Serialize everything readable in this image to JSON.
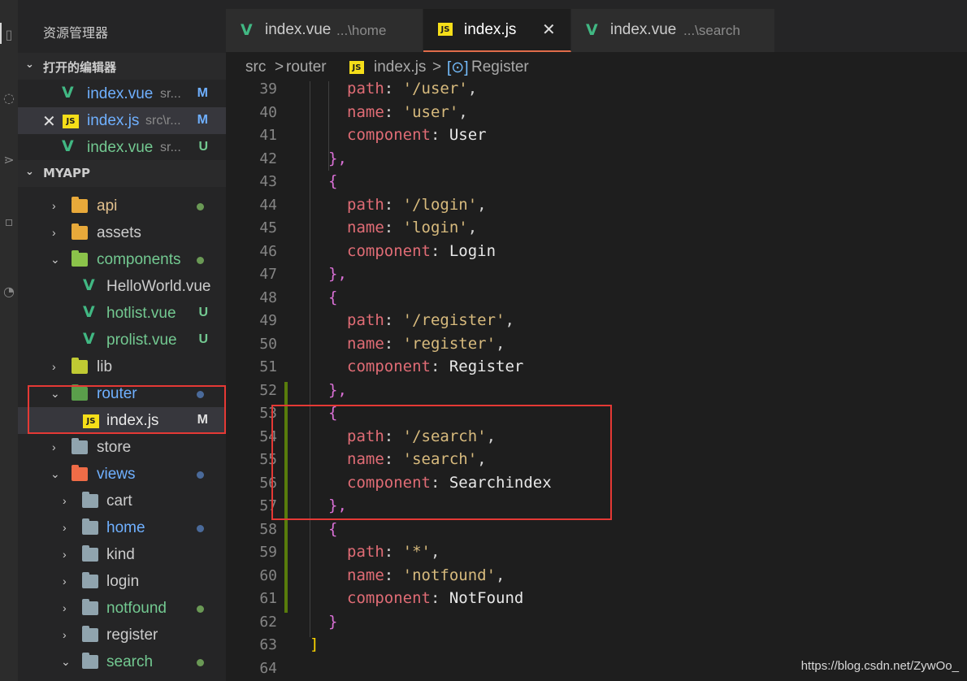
{
  "sidebar": {
    "title": "资源管理器",
    "open_editors": {
      "label": "打开的编辑器",
      "items": [
        {
          "name": "index.vue",
          "desc": "sr...",
          "badge": "M",
          "icon": "vue-icon"
        },
        {
          "name": "index.js",
          "desc": "src\\r...",
          "badge": "M",
          "icon": "js-icon"
        },
        {
          "name": "index.vue",
          "desc": "sr...",
          "badge": "U",
          "icon": "vue-icon"
        }
      ]
    },
    "project": {
      "label": "MYAPP",
      "tree": [
        {
          "name": "api",
          "kind": "folder",
          "expanded": false
        },
        {
          "name": "assets",
          "kind": "folder",
          "expanded": false
        },
        {
          "name": "components",
          "kind": "folder",
          "expanded": true
        },
        {
          "name": "HelloWorld.vue",
          "kind": "vue"
        },
        {
          "name": "hotlist.vue",
          "kind": "vue",
          "badge": "U"
        },
        {
          "name": "prolist.vue",
          "kind": "vue",
          "badge": "U"
        },
        {
          "name": "lib",
          "kind": "folder",
          "expanded": false
        },
        {
          "name": "router",
          "kind": "folder",
          "expanded": true
        },
        {
          "name": "index.js",
          "kind": "js",
          "badge": "M"
        },
        {
          "name": "store",
          "kind": "folder",
          "expanded": false
        },
        {
          "name": "views",
          "kind": "folder",
          "expanded": true
        },
        {
          "name": "cart",
          "kind": "folder",
          "expanded": false
        },
        {
          "name": "home",
          "kind": "folder",
          "expanded": false
        },
        {
          "name": "kind",
          "kind": "folder",
          "expanded": false
        },
        {
          "name": "login",
          "kind": "folder",
          "expanded": false
        },
        {
          "name": "notfound",
          "kind": "folder",
          "expanded": false
        },
        {
          "name": "register",
          "kind": "folder",
          "expanded": false
        },
        {
          "name": "search",
          "kind": "folder",
          "expanded": true
        }
      ]
    }
  },
  "tabs": [
    {
      "label": "index.vue",
      "desc": "...\\home",
      "icon": "vue-icon"
    },
    {
      "label": "index.js",
      "close": "✕",
      "icon": "js-icon",
      "active": true
    },
    {
      "label": "index.vue",
      "desc": "...\\search",
      "icon": "vue-icon"
    }
  ],
  "breadcrumb": {
    "parts": [
      "src",
      "router",
      "index.js",
      "Register"
    ],
    "separator": ">"
  },
  "editor": {
    "lines": [
      {
        "n": "39",
        "key": "path",
        "val": "'/user'",
        "tail": ","
      },
      {
        "n": "40",
        "key": "name",
        "val": "'user'",
        "tail": ","
      },
      {
        "n": "41",
        "key": "component",
        "ident": "User"
      },
      {
        "n": "42",
        "brace": "},"
      },
      {
        "n": "43",
        "brace": "{"
      },
      {
        "n": "44",
        "key": "path",
        "val": "'/login'",
        "tail": ","
      },
      {
        "n": "45",
        "key": "name",
        "val": "'login'",
        "tail": ","
      },
      {
        "n": "46",
        "key": "component",
        "ident": "Login"
      },
      {
        "n": "47",
        "brace": "},"
      },
      {
        "n": "48",
        "brace": "{"
      },
      {
        "n": "49",
        "key": "path",
        "val": "'/register'",
        "tail": ","
      },
      {
        "n": "50",
        "key": "name",
        "val": "'register'",
        "tail": ","
      },
      {
        "n": "51",
        "key": "component",
        "ident": "Register"
      },
      {
        "n": "52",
        "brace": "},"
      },
      {
        "n": "53",
        "brace": "{"
      },
      {
        "n": "54",
        "key": "path",
        "val": "'/search'",
        "tail": ","
      },
      {
        "n": "55",
        "key": "name",
        "val": "'search'",
        "tail": ","
      },
      {
        "n": "56",
        "key": "component",
        "ident": "Searchindex"
      },
      {
        "n": "57",
        "brace": "},"
      },
      {
        "n": "58",
        "brace": "{"
      },
      {
        "n": "59",
        "key": "path",
        "val": "'*'",
        "tail": ","
      },
      {
        "n": "60",
        "key": "name",
        "val": "'notfound'",
        "tail": ","
      },
      {
        "n": "61",
        "key": "component",
        "ident": "NotFound"
      },
      {
        "n": "62",
        "brace": "}"
      },
      {
        "n": "63",
        "array_close": "]"
      },
      {
        "n": "64"
      }
    ]
  },
  "watermark": "https://blog.csdn.net/ZywOo_",
  "colors": {
    "annotation_box": "#e53935",
    "modified": "#e2c08d",
    "untracked": "#73c991",
    "tab_active_border": "#e06c4a"
  }
}
